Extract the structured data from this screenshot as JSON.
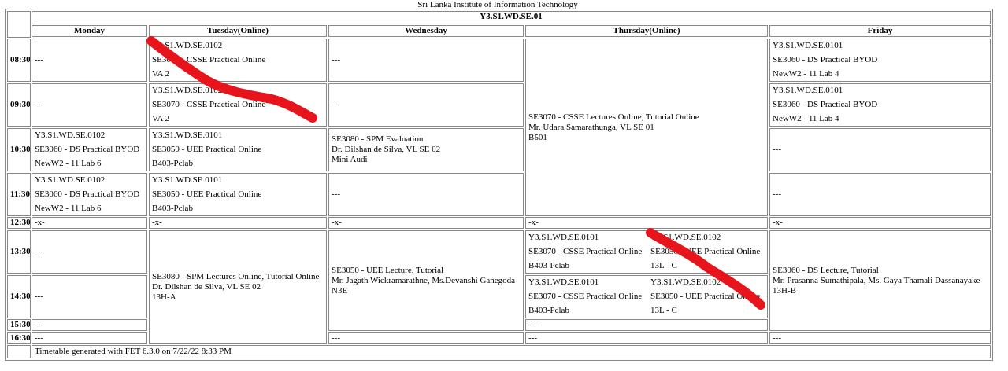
{
  "institute": "Sri Lanka Institute of Information Technology",
  "group": "Y3.S1.WD.SE.01",
  "days": [
    "Monday",
    "Tuesday(Online)",
    "Wednesday",
    "Thursday(Online)",
    "Friday"
  ],
  "hours": [
    "08:30",
    "09:30",
    "10:30",
    "11:30",
    "12:30",
    "13:30",
    "14:30",
    "15:30",
    "16:30"
  ],
  "blank": "---",
  "break": "-x-",
  "cells": {
    "tue_0830": [
      "Y3.S1.WD.SE.0102",
      "SE3070 - CSSE Practical Online",
      "VA 2"
    ],
    "tue_0930": [
      "Y3.S1.WD.SE.0102",
      "SE3070 - CSSE Practical Online",
      "VA 2"
    ],
    "fri_0830": [
      "Y3.S1.WD.SE.0101",
      "SE3060 - DS Practical BYOD",
      "NewW2 - 11 Lab 4"
    ],
    "fri_0930": [
      "Y3.S1.WD.SE.0101",
      "SE3060 - DS Practical BYOD",
      "NewW2 - 11 Lab 4"
    ],
    "thu_0830": [
      "SE3070 - CSSE Lectures Online, Tutorial Online",
      "Mr. Udara Samarathunga, VL SE 01",
      "B501"
    ],
    "mon_1030": [
      "Y3.S1.WD.SE.0102",
      "SE3060 - DS Practical BYOD",
      "NewW2 - 11 Lab 6"
    ],
    "mon_1130": [
      "Y3.S1.WD.SE.0102",
      "SE3060 - DS Practical BYOD",
      "NewW2 - 11 Lab 6"
    ],
    "tue_1030": [
      "Y3.S1.WD.SE.0101",
      "SE3050 - UEE Practical Online",
      "B403-Pclab"
    ],
    "tue_1130": [
      "Y3.S1.WD.SE.0101",
      "SE3050 - UEE Practical Online",
      "B403-Pclab"
    ],
    "wed_1030": [
      "SE3080 - SPM Evaluation",
      "Dr. Dilshan de Silva, VL SE 02",
      "Mini Audi"
    ],
    "tue_1330": [
      "SE3080 - SPM Lectures Online, Tutorial Online",
      "Dr. Dilshan de Silva, VL SE 02",
      "13H-A"
    ],
    "wed_1330": [
      "SE3050 - UEE Lecture, Tutorial",
      "Mr. Jagath Wickramarathne, Ms.Devanshi Ganegoda",
      "N3E"
    ],
    "thu_1330_a": [
      "Y3.S1.WD.SE.0101",
      "SE3070 - CSSE Practical Online",
      "B403-Pclab"
    ],
    "thu_1330_b": [
      "Y3.S1.WD.SE.0102",
      "SE3050 - UEE Practical Online",
      "13L - C"
    ],
    "thu_1430_a": [
      "Y3.S1.WD.SE.0101",
      "SE3070 - CSSE Practical Online",
      "B403-Pclab"
    ],
    "thu_1430_b": [
      "Y3.S1.WD.SE.0102",
      "SE3050 - UEE Practical Online",
      "13L - C"
    ],
    "fri_1330": [
      "SE3060 - DS Lecture, Tutorial",
      "Mr. Prasanna Sumathipala, Ms. Gaya Thamali Dassanayake",
      "13H-B"
    ]
  },
  "footer": "Timetable generated with FET 6.3.0 on 7/22/22 8:33 PM",
  "annotation_color": "#e8141b"
}
